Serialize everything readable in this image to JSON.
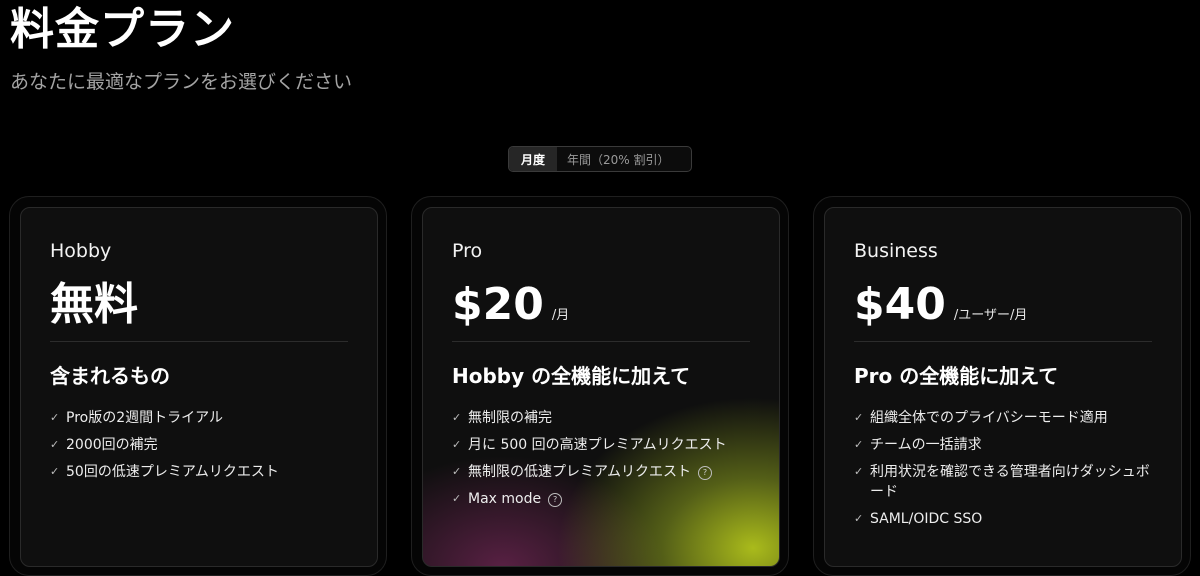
{
  "header": {
    "title": "料金プラン",
    "subtitle": "あなたに最適なプランをお選びください"
  },
  "billing_toggle": {
    "monthly_label": "月度",
    "yearly_label": "年間（20% 割引）",
    "selected": "monthly"
  },
  "plans": [
    {
      "name": "Hobby",
      "price": "無料",
      "price_unit": "",
      "section_heading": "含まれるもの",
      "features": [
        {
          "text": "Pro版の2週間トライアル"
        },
        {
          "text": "2000回の補完"
        },
        {
          "text": "50回の低速プレミアムリクエスト"
        }
      ]
    },
    {
      "name": "Pro",
      "price": "$20",
      "price_unit": "/月",
      "section_heading": "Hobby の全機能に加えて",
      "features": [
        {
          "text": "無制限の補完"
        },
        {
          "text": "月に 500 回の高速プレミアムリクエスト"
        },
        {
          "text": "無制限の低速プレミアムリクエスト",
          "info": "?"
        },
        {
          "text": "Max mode",
          "info": "?"
        }
      ]
    },
    {
      "name": "Business",
      "price": "$40",
      "price_unit": "/ユーザー/月",
      "section_heading": "Pro の全機能に加えて",
      "features": [
        {
          "text": "組織全体でのプライバシーモード適用"
        },
        {
          "text": "チームの一括請求"
        },
        {
          "text": "利用状況を確認できる管理者向けダッシュボード"
        },
        {
          "text": "SAML/OIDC SSO"
        }
      ]
    }
  ],
  "icons": {
    "check": "checkmark-icon",
    "info": "question-circle-icon"
  },
  "colors": {
    "background": "#000000",
    "card": "#0f0f0f",
    "pro_accent": "#b2c41c"
  }
}
